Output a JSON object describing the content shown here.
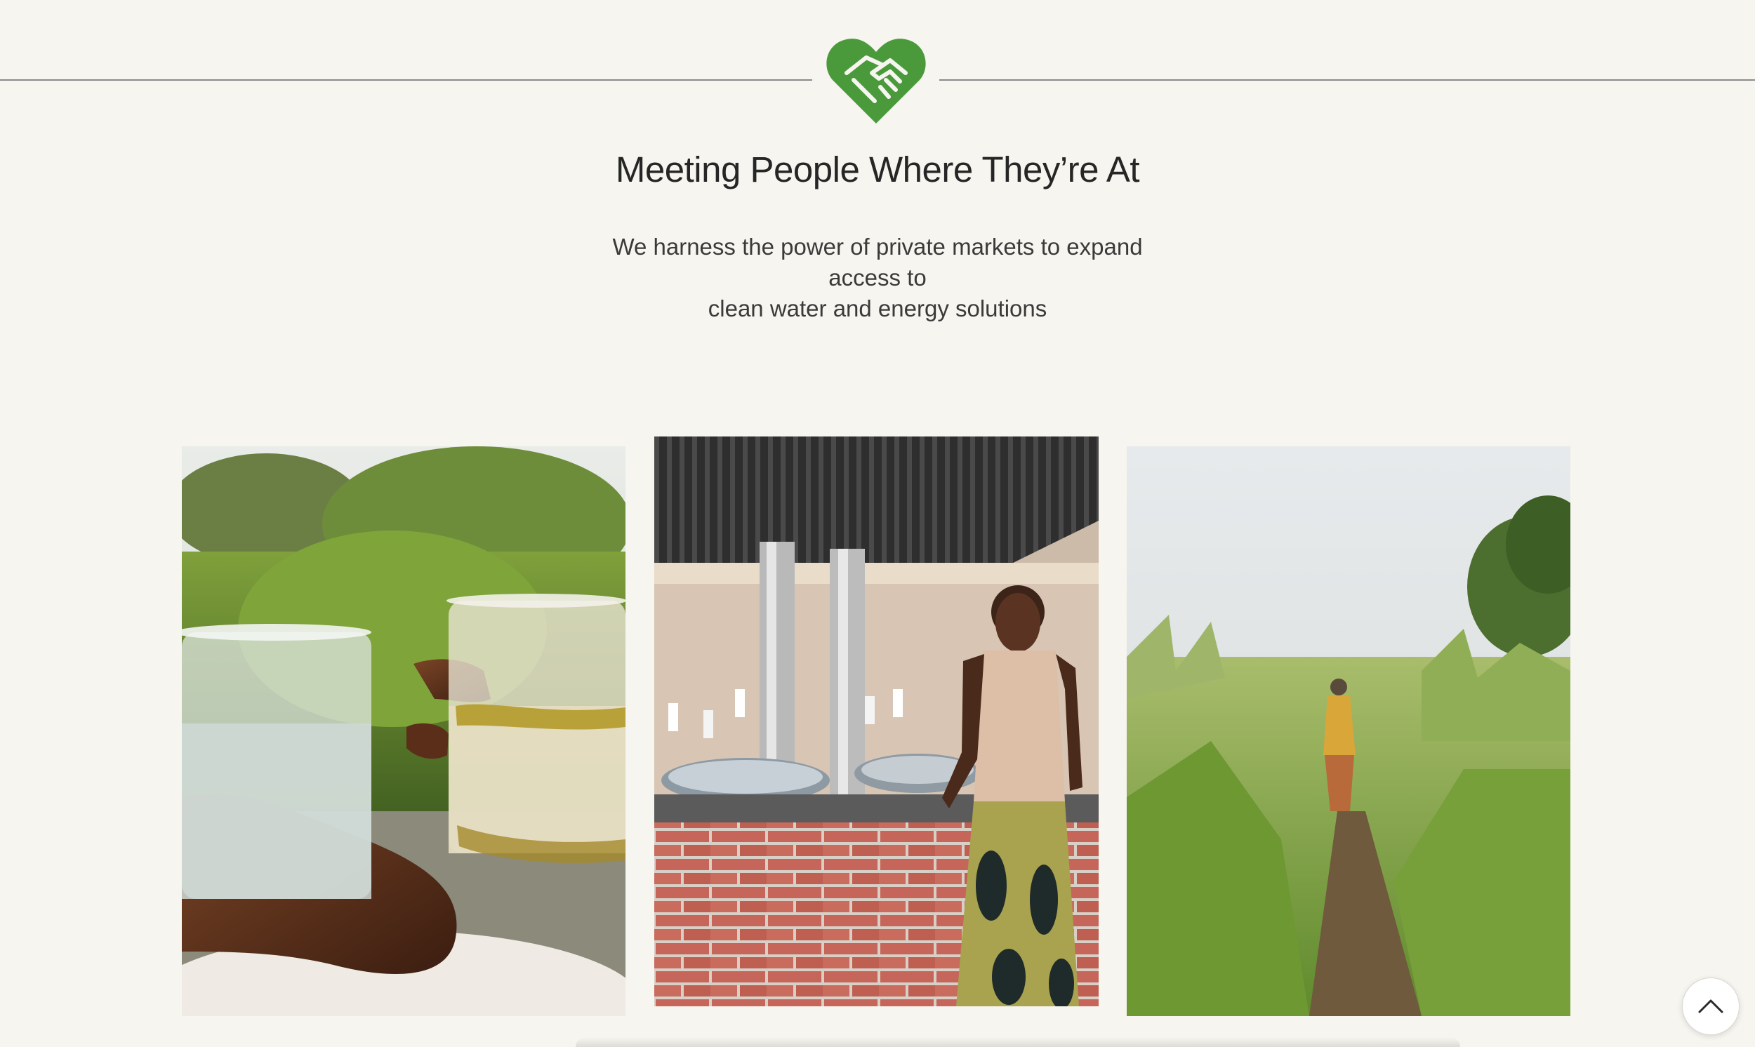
{
  "header": {
    "logo_icon": "heart-handshake-icon",
    "brand_color": "#4a9a3c",
    "title": "Meeting People Where They’re At",
    "subtitle_line1": "We harness the power of private markets to expand access to",
    "subtitle_line2": "clean water and energy solutions"
  },
  "gallery": {
    "photos": [
      {
        "name": "water-glasses-photo"
      },
      {
        "name": "woman-water-tank-photo"
      },
      {
        "name": "woman-field-path-photo"
      }
    ]
  },
  "controls": {
    "scroll_top_icon": "chevron-up-icon"
  },
  "colors": {
    "background": "#f6f5ef",
    "text": "#2d2d2d"
  }
}
